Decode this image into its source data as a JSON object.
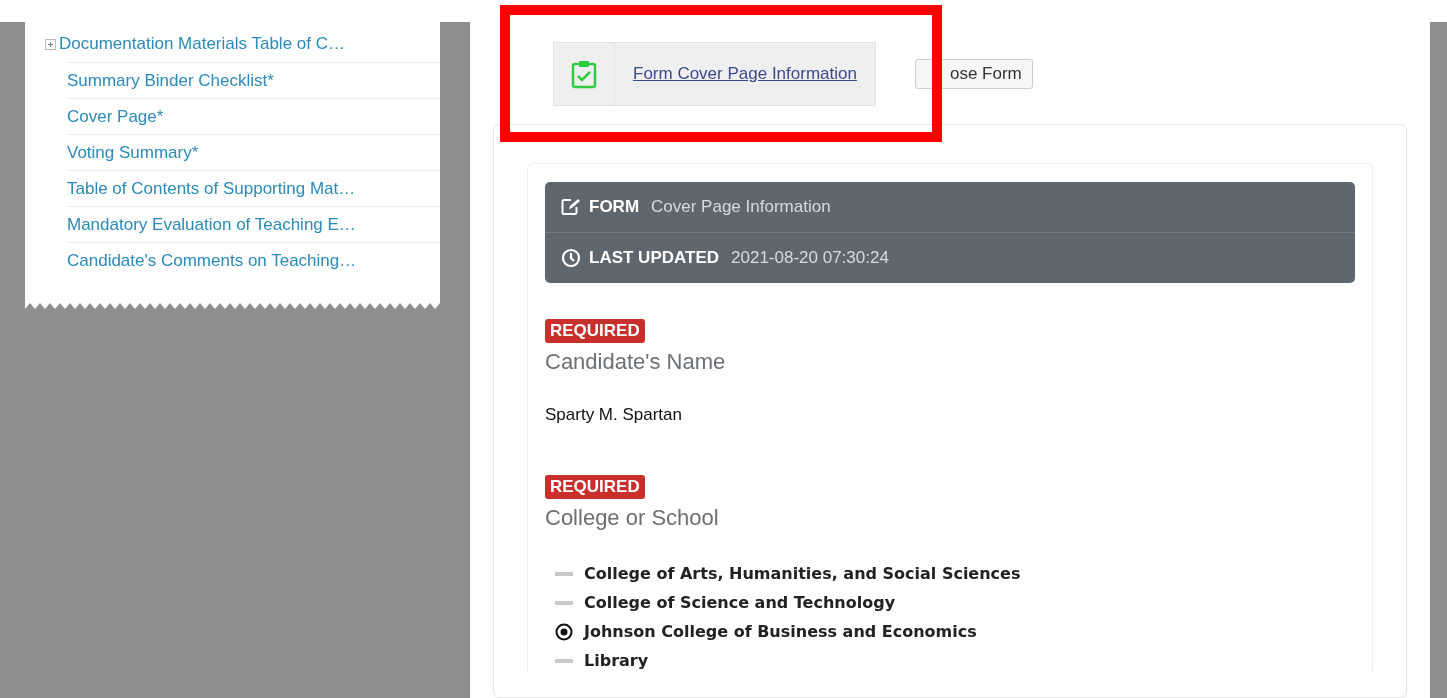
{
  "sidebar": {
    "items": [
      {
        "label": "Documentation Materials Table of C…",
        "expandable": true
      },
      {
        "label": "Summary Binder Checklist*",
        "expandable": false
      },
      {
        "label": "Cover Page*",
        "expandable": false
      },
      {
        "label": "Voting Summary*",
        "expandable": false
      },
      {
        "label": "Table of Contents of Supporting Mat…",
        "expandable": false
      },
      {
        "label": "Mandatory Evaluation of Teaching E…",
        "expandable": false
      },
      {
        "label": "Candidate's Comments on Teaching…",
        "expandable": false
      }
    ]
  },
  "form_tab": {
    "link": "Form Cover Page Information",
    "close_button": "ose Form"
  },
  "header": {
    "form_label": "FORM",
    "form_name": "Cover Page Information",
    "updated_label": "LAST UPDATED",
    "updated_value": "2021-08-20 07:30:24"
  },
  "fields": [
    {
      "kind": "text",
      "badge": "REQUIRED",
      "label": "Candidate's Name",
      "value": "Sparty M. Spartan"
    },
    {
      "kind": "radio",
      "badge": "REQUIRED",
      "label": "College or School",
      "options": [
        {
          "label": "College of Arts, Humanities, and Social Sciences",
          "selected": false
        },
        {
          "label": "College of Science and Technology",
          "selected": false
        },
        {
          "label": "Johnson College of Business and Economics",
          "selected": true
        },
        {
          "label": "Library",
          "selected": false
        }
      ]
    }
  ]
}
